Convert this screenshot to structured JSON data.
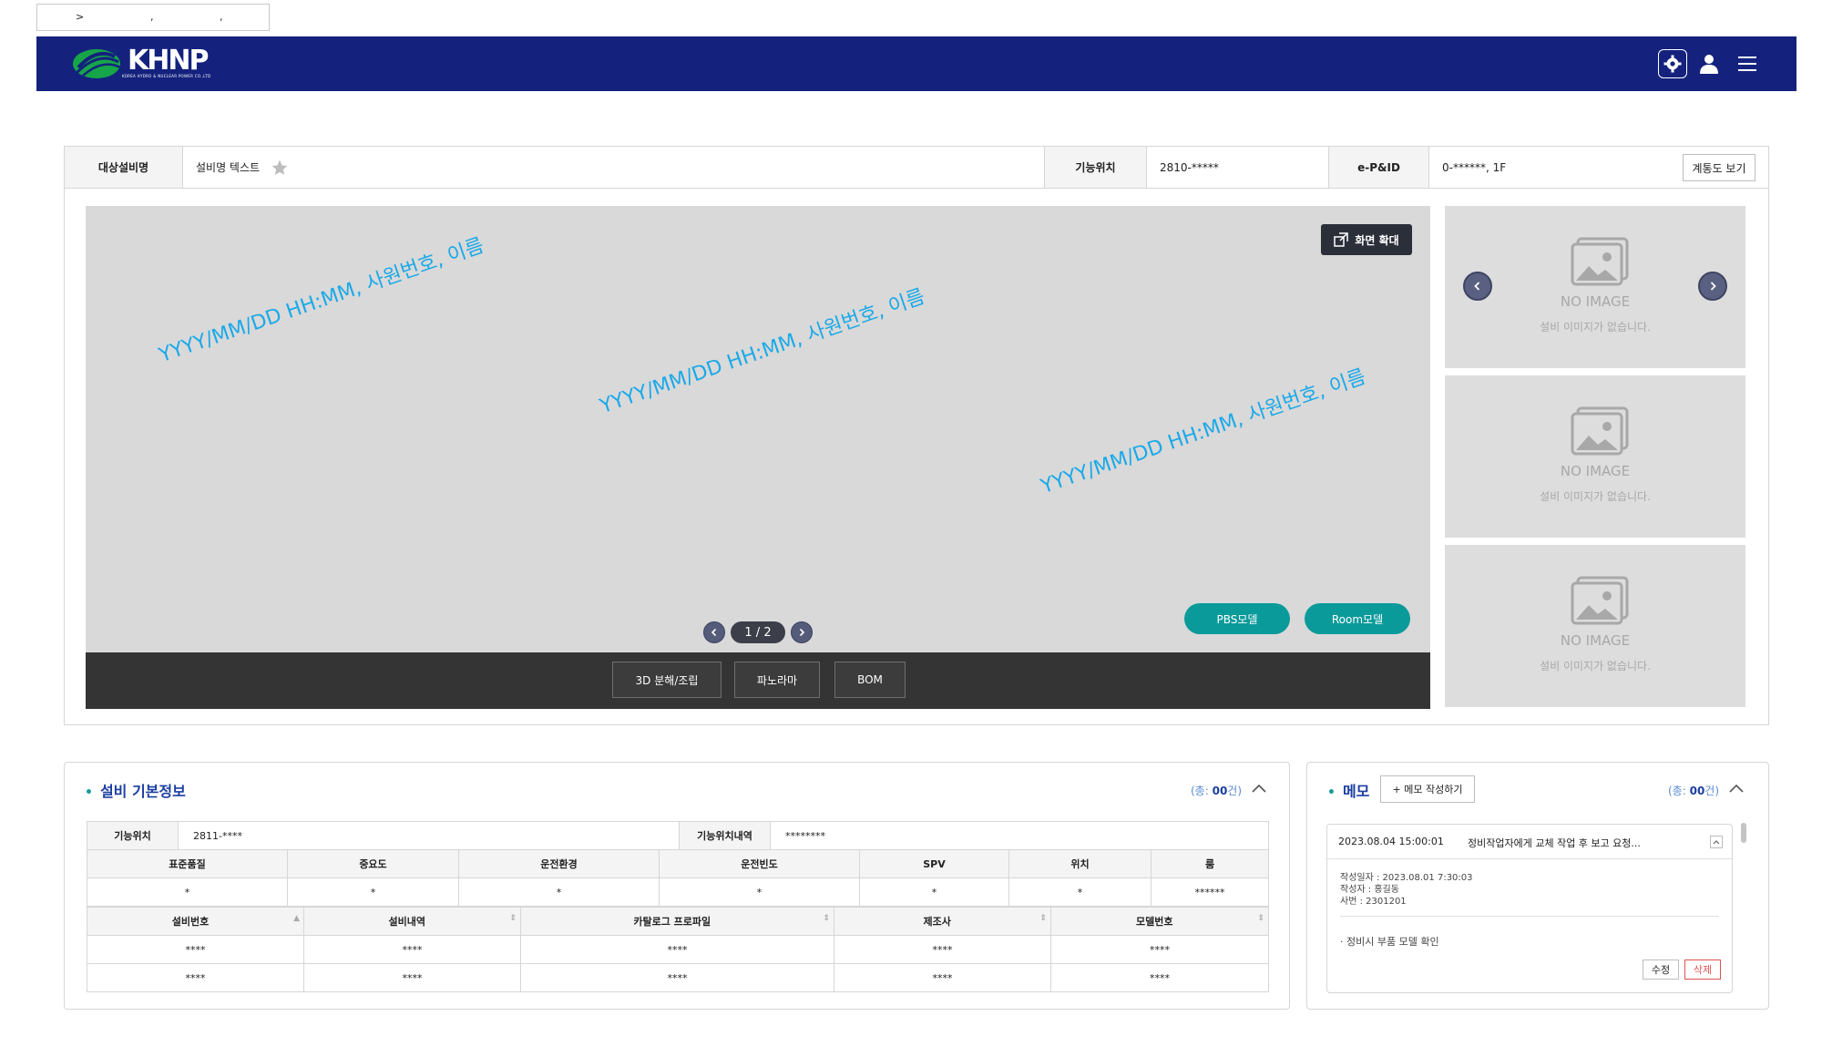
{
  "breadcrumb": {
    "sep1": ">",
    "sep2": ",",
    "sep3": ","
  },
  "header": {
    "logo_text": "KHNP",
    "logo_subtitle": "KOREA HYDRO & NUCLEAR POWER CO.,LTD",
    "icons": [
      "gear-icon",
      "user-icon",
      "menu-icon"
    ]
  },
  "equipment": {
    "target_label": "대상설비명",
    "target_value": "설비명 텍스트",
    "location_label": "기능위치",
    "location_value": "2810-*****",
    "epid_label": "e-P&ID",
    "epid_value": "0-******, 1F",
    "diagram_button": "계통도 보기"
  },
  "viewer": {
    "zoom_button": "화면 확대",
    "watermark": "YYYY/MM/DD HH:MM, 사원번호, 이름",
    "page_indicator": "1 / 2",
    "pbs_button": "PBS모델",
    "room_button": "Room모델",
    "toolbar": [
      "3D 분해/조립",
      "파노라마",
      "BOM"
    ]
  },
  "thumbnails": [
    {
      "title": "NO IMAGE",
      "text": "설비 이미지가 없습니다."
    },
    {
      "title": "NO IMAGE",
      "text": "설비 이미지가 없습니다."
    },
    {
      "title": "NO IMAGE",
      "text": "설비 이미지가 없습니다."
    }
  ],
  "basic_info": {
    "title": "설비 기본정보",
    "count_prefix": "(총: ",
    "count_value": "00",
    "count_suffix": "건)",
    "row1": {
      "loc_label": "기능위치",
      "loc_value": "2811-****",
      "desc_label": "기능위치내역",
      "desc_value": "********"
    },
    "header2": [
      "표준품질",
      "중요도",
      "운전환경",
      "운전빈도",
      "SPV",
      "위치",
      "룸"
    ],
    "values2": [
      "*",
      "*",
      "*",
      "*",
      "*",
      "*",
      "******"
    ],
    "header3": [
      "설비번호",
      "설비내역",
      "카탈로그 프로파일",
      "제조사",
      "모델번호"
    ],
    "rows3": [
      [
        "****",
        "****",
        "****",
        "****",
        "****"
      ],
      [
        "****",
        "****",
        "****",
        "****",
        "****"
      ]
    ]
  },
  "memo": {
    "title": "메모",
    "write_button": "+ 메모 작성하기",
    "count_prefix": "(총: ",
    "count_value": "00",
    "count_suffix": "건)",
    "item": {
      "date": "2023.08.04 15:00:01",
      "subject": "정비작업자에게 교체 작업 후 보고 요청...",
      "written_at": "작성일자 : 2023.08.01 7:30:03",
      "author": "작성자 : 홍길동",
      "emp_no": "사번 : 2301201",
      "body": "· 정비시 부품 모델 확인",
      "edit": "수정",
      "delete": "삭제"
    }
  },
  "colors": {
    "header": "#14227d",
    "teal": "#0b9a9a",
    "watermark": "#1aa9e8",
    "title": "#1b3ea0"
  }
}
